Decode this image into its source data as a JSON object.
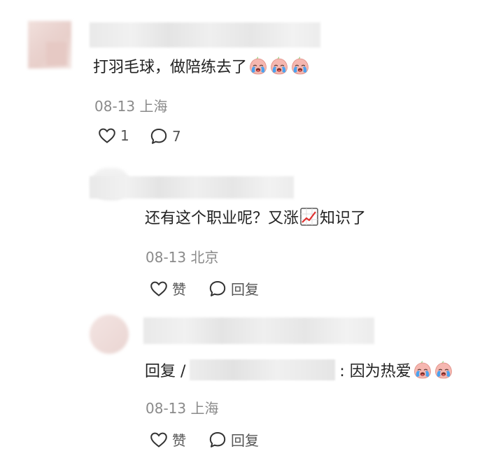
{
  "main_comment": {
    "text": "打羽毛球，做陪练去了",
    "emoji_count": 3,
    "meta": "08-13 上海",
    "like_count": "1",
    "reply_count": "7"
  },
  "reply1": {
    "text_before": "还有这个职业呢？又涨",
    "text_after": "知识了",
    "meta": "08-13 北京",
    "like_label": "赞",
    "reply_label": "回复"
  },
  "reply2": {
    "prefix": "回复 /",
    "text": ": 因为热爱",
    "emoji_count": 2,
    "meta": "08-13 上海",
    "like_label": "赞",
    "reply_label": "回复"
  },
  "icons": {
    "like": "heart-outline-icon",
    "comment": "speech-bubble-icon",
    "emoji": "crying-face-emoji",
    "chart": "chart-increasing-emoji"
  }
}
